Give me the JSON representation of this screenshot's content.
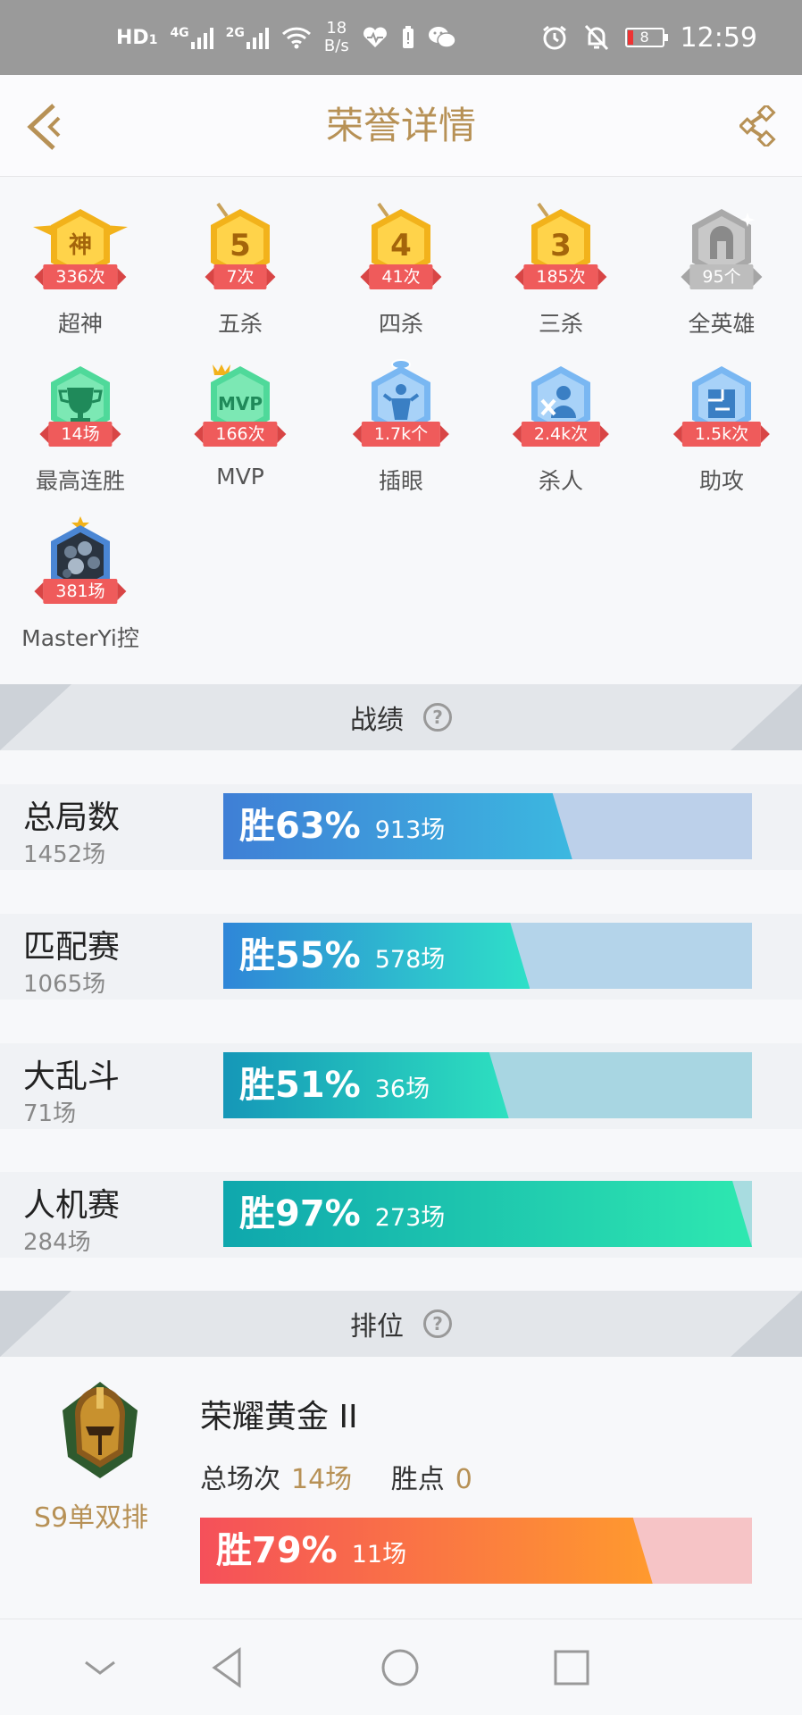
{
  "status_bar": {
    "hd_label": "HD",
    "sim1": "1",
    "net1": "4G",
    "net2": "2G",
    "speed_value": "18",
    "speed_unit": "B/s",
    "battery": "8",
    "time": "12:59"
  },
  "header": {
    "title": "荣誉详情"
  },
  "honors": [
    {
      "label": "超神",
      "count": "336次",
      "icon": "god-badge-icon",
      "color": "#f2b21b"
    },
    {
      "label": "五杀",
      "count": "7次",
      "icon": "penta-kill-badge-icon",
      "color": "#f2b21b"
    },
    {
      "label": "四杀",
      "count": "41次",
      "icon": "quadra-kill-badge-icon",
      "color": "#f2b21b"
    },
    {
      "label": "三杀",
      "count": "185次",
      "icon": "triple-kill-badge-icon",
      "color": "#f2b21b"
    },
    {
      "label": "全英雄",
      "count": "95个",
      "icon": "all-heroes-badge-icon",
      "color": "#a9a9a9"
    },
    {
      "label": "最高连胜",
      "count": "14场",
      "icon": "trophy-badge-icon",
      "color": "#4fd99a"
    },
    {
      "label": "MVP",
      "count": "166次",
      "icon": "mvp-badge-icon",
      "color": "#4fd99a"
    },
    {
      "label": "插眼",
      "count": "1.7k个",
      "icon": "ward-badge-icon",
      "color": "#79b7f2"
    },
    {
      "label": "杀人",
      "count": "2.4k次",
      "icon": "kill-badge-icon",
      "color": "#79b7f2"
    },
    {
      "label": "助攻",
      "count": "1.5k次",
      "icon": "assist-badge-icon",
      "color": "#79b7f2"
    },
    {
      "label": "MasterYi控",
      "count": "381场",
      "icon": "hero-masteryi-badge-icon",
      "color": "#4a86d4"
    }
  ],
  "sections": {
    "stats_title": "战绩",
    "rank_title": "排位"
  },
  "stats": [
    {
      "name": "总局数",
      "total": "1452场",
      "win_label": "胜63%",
      "wins": "913场",
      "win_rate": 63,
      "fill_from": "#3f7fd6",
      "fill_to": "#3cb8e0",
      "track": "#bcd0ea"
    },
    {
      "name": "匹配赛",
      "total": "1065场",
      "win_label": "胜55%",
      "wins": "578场",
      "win_rate": 55,
      "fill_from": "#2f86d8",
      "fill_to": "#2ee0c8",
      "track": "#b4d4ea"
    },
    {
      "name": "大乱斗",
      "total": "71场",
      "win_label": "胜51%",
      "wins": "36场",
      "win_rate": 51,
      "fill_from": "#1597b8",
      "fill_to": "#2ee0c0",
      "track": "#a8d6e2"
    },
    {
      "name": "人机赛",
      "total": "284场",
      "win_label": "胜97%",
      "wins": "273场",
      "win_rate": 97,
      "fill_from": "#0fa7ad",
      "fill_to": "#2ee8b0",
      "track": "#a8dce0"
    }
  ],
  "rank": {
    "tier": "荣耀黄金 II",
    "season": "S9单双排",
    "total_label": "总场次",
    "total_value": "14场",
    "points_label": "胜点",
    "points_value": "0",
    "win_label": "胜79%",
    "wins": "11场",
    "win_rate": 79,
    "fill_from": "#f5505a",
    "fill_to": "#ff9a2e",
    "track": "#f6c4c6"
  }
}
